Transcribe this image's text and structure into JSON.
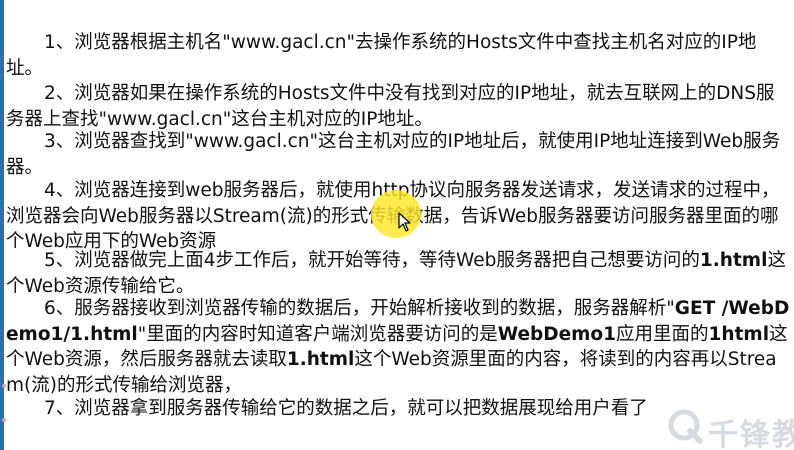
{
  "slide": {
    "p1": {
      "text1": "1、浏览器根据主机名\"www.gacl.cn\"去操作系统的Hosts文件中查找主机名对应的IP地址。"
    },
    "p2": {
      "text1": "2、浏览器如果在操作系统的Hosts文件中没有找到对应的IP地址，就去互联网上的DNS服务器上查找\"www.gacl.cn\"这台主机对应的IP地址。"
    },
    "p3": {
      "text1": "3、浏览器查找到\"www.gacl.cn\"这台主机对应的IP地址后，就使用IP地址连接到Web服务器。"
    },
    "p4": {
      "text1": "4、浏览器连接到web服务器后，就使用http协议向服务器发送请求，发送请求的过程中，浏览器会向Web服务器以Stream(流)的形式传输数据，告诉Web服务器要访问服务器里面的哪个Web应用下的Web资源"
    },
    "p5": {
      "text1": "5、浏览器做完上面4步工作后，就开始等待，等待Web服务器把自己想要访问的",
      "bold1": "1.html",
      "text2": "这个Web资源传输给它。"
    },
    "p6": {
      "text1": "6、服务器接收到浏览器传输的数据后，开始解析接收到的数据，服务器解析\"",
      "bold1": "GET /WebDemo1/1.html",
      "text2": "\"里面的内容时知道客户端浏览器要访问的是",
      "bold2": "WebDemo1",
      "text3": "应用里面的",
      "bold3": "1html",
      "text4": "这个Web资源，然后服务器就去读取",
      "bold4": "1.html",
      "text5": "这个Web资源里面的内容，将读到的内容再以Stream(流)的形式传输给浏览器，"
    },
    "p7": {
      "text1": "7、浏览器拿到服务器传输给它的数据之后，就可以把数据展现给用户看了"
    }
  },
  "watermark": {
    "text": "千锋教"
  },
  "colors": {
    "accent": "#2a6fb0",
    "highlight": "#ffe628",
    "watermark": "#8a9aa8"
  },
  "icons": {
    "cursor": "mouse-pointer-icon",
    "watermark_logo": "qianfeng-logo-icon"
  }
}
